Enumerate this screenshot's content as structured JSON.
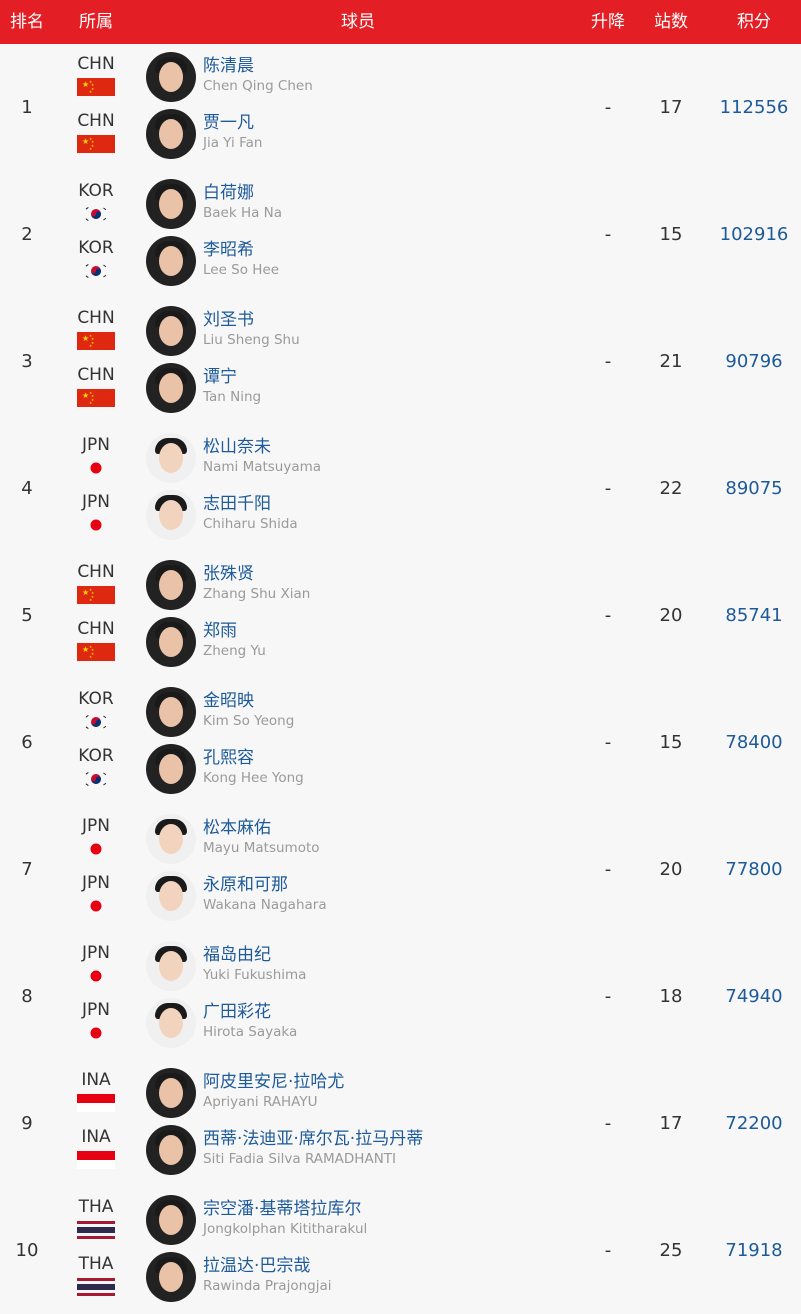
{
  "header": {
    "rank": "排名",
    "country": "所属",
    "player": "球员",
    "change": "升降",
    "events": "站数",
    "points": "积分"
  },
  "accent_color": "#e31e24",
  "link_color": "#1d5a9a",
  "rows": [
    {
      "rank": "1",
      "change": "-",
      "events": "17",
      "points": "112556",
      "players": [
        {
          "country": "CHN",
          "flag": "china-flag-icon",
          "name_cn": "陈清晨",
          "name_en": "Chen Qing Chen"
        },
        {
          "country": "CHN",
          "flag": "china-flag-icon",
          "name_cn": "贾一凡",
          "name_en": "Jia Yi Fan"
        }
      ]
    },
    {
      "rank": "2",
      "change": "-",
      "events": "15",
      "points": "102916",
      "players": [
        {
          "country": "KOR",
          "flag": "korea-flag-icon",
          "name_cn": "白荷娜",
          "name_en": "Baek Ha Na"
        },
        {
          "country": "KOR",
          "flag": "korea-flag-icon",
          "name_cn": "李昭希",
          "name_en": "Lee So Hee"
        }
      ]
    },
    {
      "rank": "3",
      "change": "-",
      "events": "21",
      "points": "90796",
      "players": [
        {
          "country": "CHN",
          "flag": "china-flag-icon",
          "name_cn": "刘圣书",
          "name_en": "Liu Sheng Shu"
        },
        {
          "country": "CHN",
          "flag": "china-flag-icon",
          "name_cn": "谭宁",
          "name_en": "Tan Ning"
        }
      ]
    },
    {
      "rank": "4",
      "change": "-",
      "events": "22",
      "points": "89075",
      "players": [
        {
          "country": "JPN",
          "flag": "japan-flag-icon",
          "name_cn": "松山奈未",
          "name_en": "Nami Matsuyama"
        },
        {
          "country": "JPN",
          "flag": "japan-flag-icon",
          "name_cn": "志田千阳",
          "name_en": "Chiharu Shida"
        }
      ]
    },
    {
      "rank": "5",
      "change": "-",
      "events": "20",
      "points": "85741",
      "players": [
        {
          "country": "CHN",
          "flag": "china-flag-icon",
          "name_cn": "张殊贤",
          "name_en": "Zhang Shu Xian"
        },
        {
          "country": "CHN",
          "flag": "china-flag-icon",
          "name_cn": "郑雨",
          "name_en": "Zheng Yu"
        }
      ]
    },
    {
      "rank": "6",
      "change": "-",
      "events": "15",
      "points": "78400",
      "players": [
        {
          "country": "KOR",
          "flag": "korea-flag-icon",
          "name_cn": "金昭映",
          "name_en": "Kim So Yeong"
        },
        {
          "country": "KOR",
          "flag": "korea-flag-icon",
          "name_cn": "孔熙容",
          "name_en": "Kong Hee Yong"
        }
      ]
    },
    {
      "rank": "7",
      "change": "-",
      "events": "20",
      "points": "77800",
      "players": [
        {
          "country": "JPN",
          "flag": "japan-flag-icon",
          "name_cn": "松本麻佑",
          "name_en": "Mayu Matsumoto"
        },
        {
          "country": "JPN",
          "flag": "japan-flag-icon",
          "name_cn": "永原和可那",
          "name_en": "Wakana Nagahara"
        }
      ]
    },
    {
      "rank": "8",
      "change": "-",
      "events": "18",
      "points": "74940",
      "players": [
        {
          "country": "JPN",
          "flag": "japan-flag-icon",
          "name_cn": "福岛由纪",
          "name_en": "Yuki Fukushima"
        },
        {
          "country": "JPN",
          "flag": "japan-flag-icon",
          "name_cn": "广田彩花",
          "name_en": "Hirota Sayaka"
        }
      ]
    },
    {
      "rank": "9",
      "change": "-",
      "events": "17",
      "points": "72200",
      "players": [
        {
          "country": "INA",
          "flag": "indonesia-flag-icon",
          "name_cn": "阿皮里安尼·拉哈尤",
          "name_en": "Apriyani RAHAYU"
        },
        {
          "country": "INA",
          "flag": "indonesia-flag-icon",
          "name_cn": "西蒂·法迪亚·席尔瓦·拉马丹蒂",
          "name_en": "Siti Fadia Silva RAMADHANTI"
        }
      ]
    },
    {
      "rank": "10",
      "change": "-",
      "events": "25",
      "points": "71918",
      "players": [
        {
          "country": "THA",
          "flag": "thailand-flag-icon",
          "name_cn": "宗空潘·基蒂塔拉库尔",
          "name_en": "Jongkolphan Kititharakul"
        },
        {
          "country": "THA",
          "flag": "thailand-flag-icon",
          "name_cn": "拉温达·巴宗哉",
          "name_en": "Rawinda Prajongjai"
        }
      ]
    }
  ]
}
